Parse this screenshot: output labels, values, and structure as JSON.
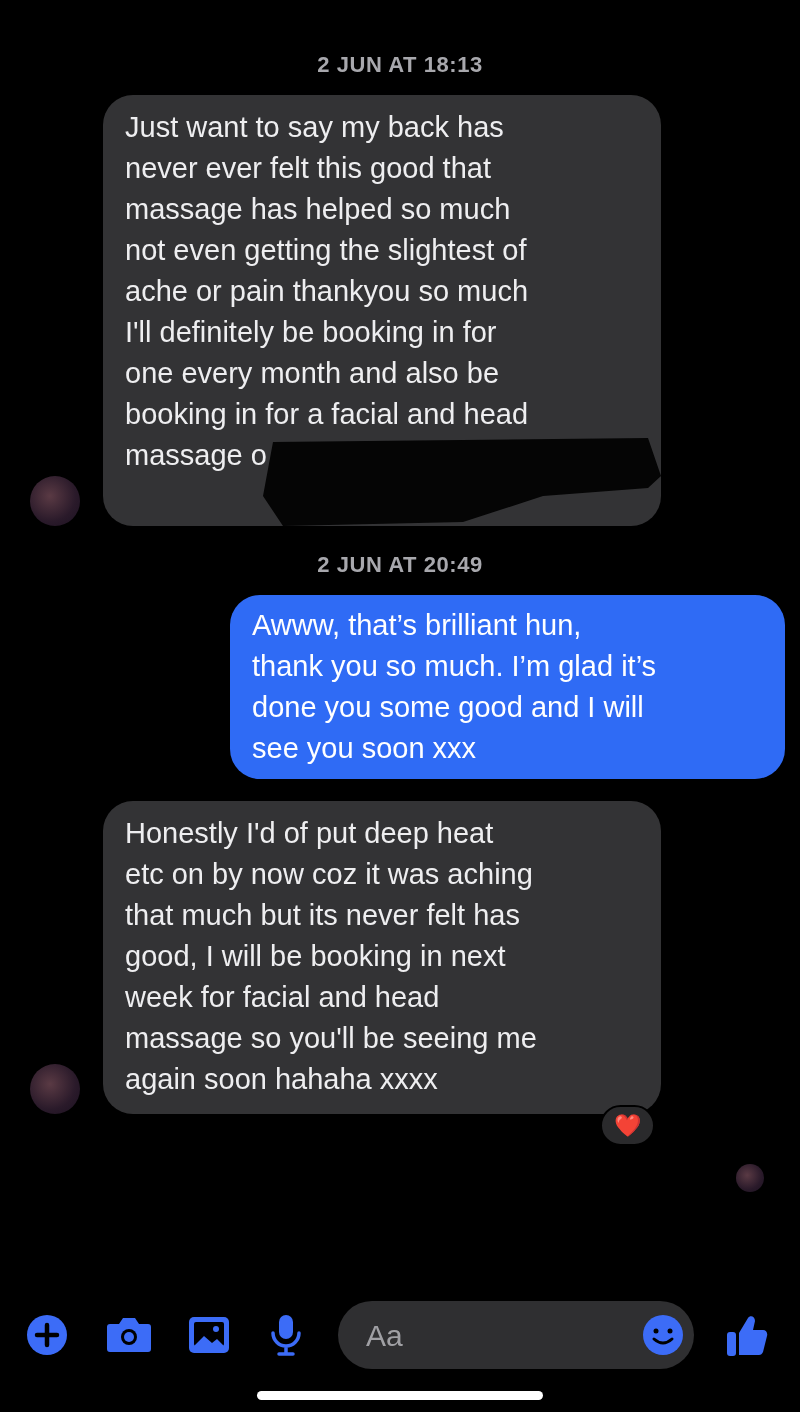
{
  "messages": [
    {
      "kind": "timestamp",
      "text": "2 JUN AT 18:13"
    },
    {
      "kind": "incoming",
      "text": "Just want to say my back has\nnever ever felt this good that\nmassage has helped so much\nnot even getting the slightest of\nache or pain thankyou so much\nI'll definitely be booking in for\none every month and also be\nbooking in for a facial and head\nmassage o",
      "redacted": true
    },
    {
      "kind": "timestamp",
      "text": "2 JUN AT 20:49"
    },
    {
      "kind": "outgoing",
      "text": "Awww, that’s brilliant hun,\nthank you so much. I’m glad it’s\ndone you some good and I will\nsee you soon xxx"
    },
    {
      "kind": "incoming",
      "text": "Honestly I'd of put deep heat\netc on by now coz it was aching\nthat much but its never felt has\ngood, I will be booking in next\nweek for facial and head\nmassage so you'll be seeing me\nagain soon hahaha xxxx",
      "reaction": "❤️"
    }
  ],
  "read_receipt": true,
  "composer": {
    "placeholder": "Aa"
  }
}
